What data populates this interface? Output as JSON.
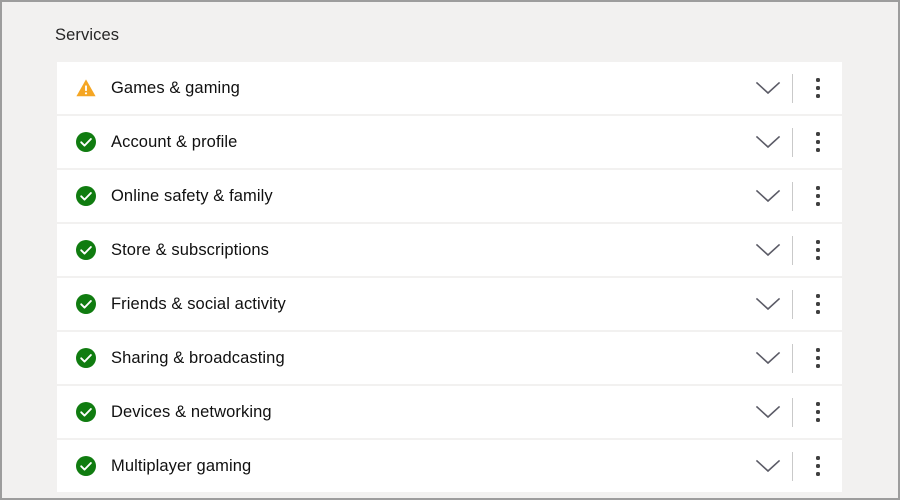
{
  "page": {
    "title": "Services"
  },
  "colors": {
    "page_background": "#f2f1f0",
    "frame_border": "#9d9d9d",
    "row_background": "#ffffff",
    "status_ok": "#107c10",
    "status_warning": "#f5a623",
    "label_text": "#101010",
    "title_text": "#262626",
    "divider": "#c9c9c9",
    "kebab_dot": "#3f3f3f"
  },
  "row_actions": {
    "expand_icon": "chevron-down-icon",
    "expand_label": "Expand",
    "more_icon": "kebab-menu-icon",
    "more_label": "More options"
  },
  "services": [
    {
      "label": "Games & gaming",
      "status": "warning",
      "status_icon": "warning-triangle-icon",
      "status_text": "Warning"
    },
    {
      "label": "Account & profile",
      "status": "ok",
      "status_icon": "check-circle-icon",
      "status_text": "Up and running"
    },
    {
      "label": "Online safety & family",
      "status": "ok",
      "status_icon": "check-circle-icon",
      "status_text": "Up and running"
    },
    {
      "label": "Store & subscriptions",
      "status": "ok",
      "status_icon": "check-circle-icon",
      "status_text": "Up and running"
    },
    {
      "label": "Friends & social activity",
      "status": "ok",
      "status_icon": "check-circle-icon",
      "status_text": "Up and running"
    },
    {
      "label": "Sharing & broadcasting",
      "status": "ok",
      "status_icon": "check-circle-icon",
      "status_text": "Up and running"
    },
    {
      "label": "Devices & networking",
      "status": "ok",
      "status_icon": "check-circle-icon",
      "status_text": "Up and running"
    },
    {
      "label": "Multiplayer gaming",
      "status": "ok",
      "status_icon": "check-circle-icon",
      "status_text": "Up and running"
    }
  ]
}
